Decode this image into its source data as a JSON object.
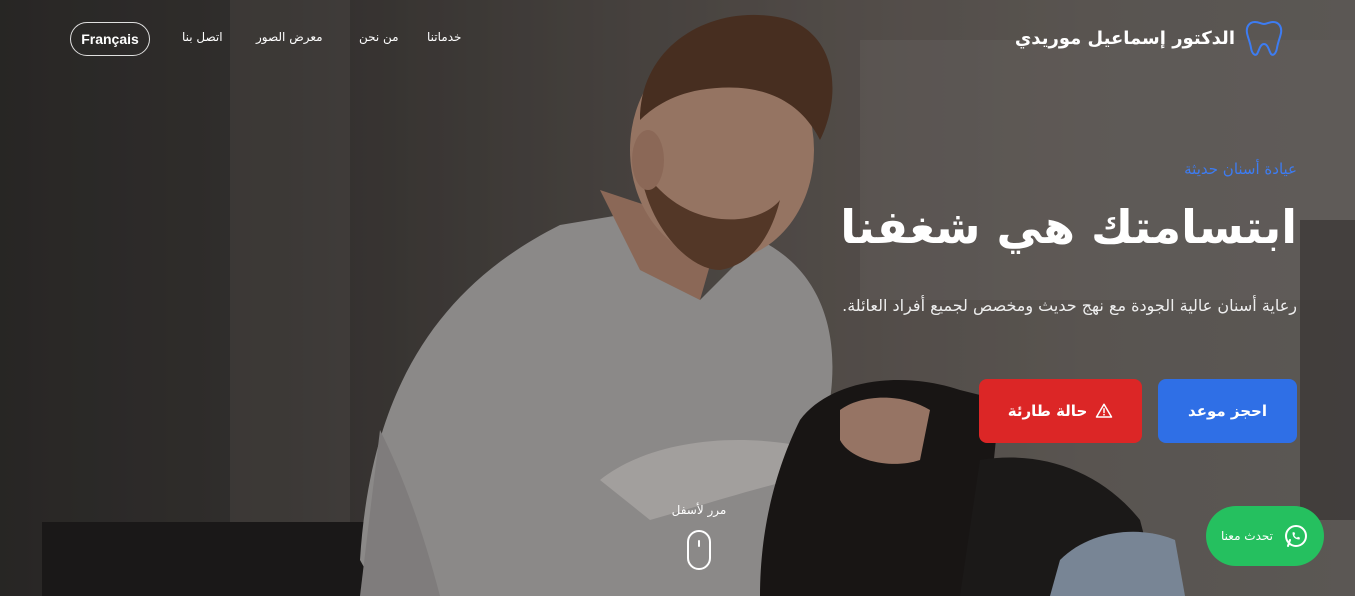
{
  "header": {
    "brand_name": "الدكتور إسماعيل موريدي",
    "brand_icon": "tooth-icon",
    "nav": [
      {
        "label": "خدماتنا"
      },
      {
        "label": "من نحن"
      },
      {
        "label": "معرض الصور"
      },
      {
        "label": "اتصل بنا"
      }
    ],
    "language_button": "Français"
  },
  "hero": {
    "tagline": "عيادة أسنان حديثة",
    "headline": "ابتسامتك هي شغفنا",
    "subtitle": "رعاية أسنان عالية الجودة مع نهج حديث ومخصص لجميع أفراد العائلة.",
    "book_button": "احجز موعد",
    "emergency_button": "حالة طارئة",
    "emergency_icon": "warning-triangle-icon",
    "scroll_label": "مرر لأسفل"
  },
  "whatsapp": {
    "label": "تحدث معنا",
    "icon": "whatsapp-icon"
  },
  "colors": {
    "accent_blue": "#2f6fe6",
    "tagline_blue": "#3d7cf2",
    "emergency_red": "#dc2626",
    "whatsapp_green": "#25c05f"
  }
}
